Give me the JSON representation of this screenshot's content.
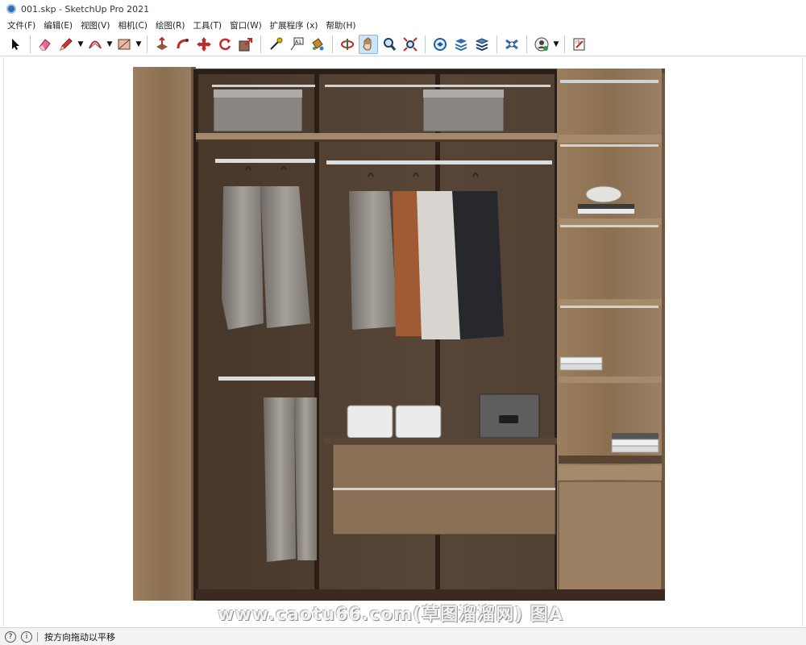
{
  "window": {
    "title": "001.skp - SketchUp Pro 2021"
  },
  "menubar": {
    "items": [
      {
        "label": "文件(F)"
      },
      {
        "label": "编辑(E)"
      },
      {
        "label": "视图(V)"
      },
      {
        "label": "相机(C)"
      },
      {
        "label": "绘图(R)"
      },
      {
        "label": "工具(T)"
      },
      {
        "label": "窗口(W)"
      },
      {
        "label": "扩展程序 (x)"
      },
      {
        "label": "帮助(H)"
      }
    ]
  },
  "toolbar": {
    "tools": [
      {
        "icon": "select-arrow-icon"
      },
      {
        "icon": "eraser-icon"
      },
      {
        "icon": "pencil-line-icon"
      },
      {
        "icon": "arc-icon"
      },
      {
        "icon": "rectangle-icon"
      },
      {
        "icon": "push-pull-icon"
      },
      {
        "icon": "follow-me-icon"
      },
      {
        "icon": "move-icon"
      },
      {
        "icon": "rotate-icon"
      },
      {
        "icon": "scale-icon"
      },
      {
        "icon": "tape-measure-icon"
      },
      {
        "icon": "text-label-icon"
      },
      {
        "icon": "paint-bucket-icon"
      },
      {
        "icon": "orbit-icon"
      },
      {
        "icon": "pan-hand-icon",
        "active": true
      },
      {
        "icon": "zoom-icon"
      },
      {
        "icon": "zoom-extents-icon"
      },
      {
        "icon": "3d-warehouse-icon"
      },
      {
        "icon": "extension-warehouse-icon"
      },
      {
        "icon": "layout-icon"
      },
      {
        "icon": "extension-manager-icon"
      },
      {
        "icon": "account-icon"
      },
      {
        "icon": "sketchup-ruby-icon"
      }
    ]
  },
  "viewport": {
    "model": "wardrobe",
    "watermark": "www.caotu66.com(草图溜溜网) 图A"
  },
  "statusbar": {
    "hint": "按方向拖动以平移"
  },
  "colors": {
    "oak": "#8d7153",
    "oak_light": "#a98f71",
    "dark_frame": "#3a2a20",
    "glass_tint": "#2b211b",
    "rail": "#d9dde0",
    "accent_blue": "#2f6db5"
  }
}
